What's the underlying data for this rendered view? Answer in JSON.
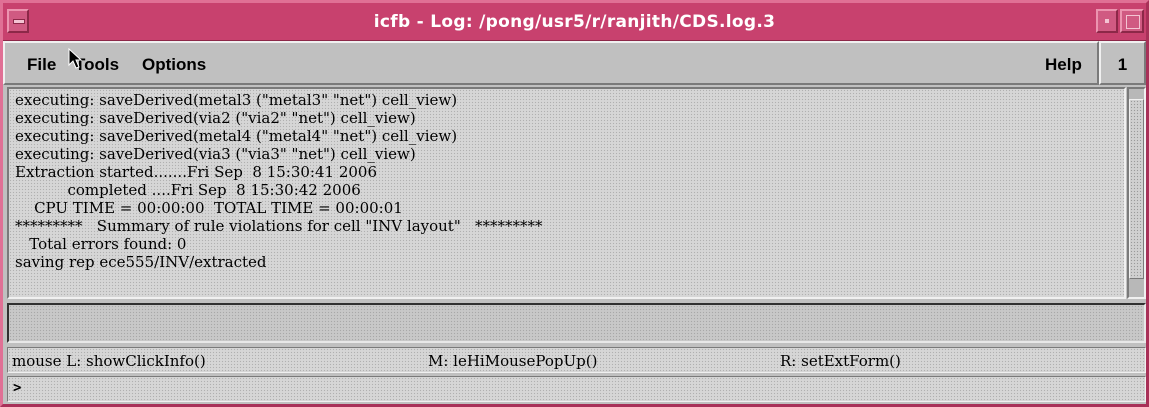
{
  "window": {
    "title": "icfb - Log: /pong/usr5/r/ranjith/CDS.log.3",
    "number": "1"
  },
  "menu": {
    "file": "File",
    "tools": "Tools",
    "options": "Options",
    "help": "Help"
  },
  "log": {
    "lines": [
      "executing: saveDerived(metal3 (\"metal3\" \"net\") cell_view)",
      "executing: saveDerived(via2 (\"via2\" \"net\") cell_view)",
      "executing: saveDerived(metal4 (\"metal4\" \"net\") cell_view)",
      "executing: saveDerived(via3 (\"via3\" \"net\") cell_view)",
      "Extraction started.......Fri Sep  8 15:30:41 2006",
      "           completed ....Fri Sep  8 15:30:42 2006",
      "    CPU TIME = 00:00:00  TOTAL TIME = 00:00:01",
      "*********   Summary of rule violations for cell \"INV layout\"   *********",
      "   Total errors found: 0",
      "saving rep ece555/INV/extracted"
    ]
  },
  "mouse_bindings": {
    "left": "mouse L: showClickInfo()",
    "middle": "M: leHiMousePopUp()",
    "right": "R: setExtForm()"
  },
  "command": {
    "prompt": ">"
  },
  "colors": {
    "titlebar": "#c8416e",
    "window_border": "#d0507a",
    "panel": "#c0c0c0"
  },
  "icons": {
    "window_menu": "window-menu-icon",
    "minimize": "minimize-icon",
    "maximize": "maximize-icon",
    "pointer": "mouse-pointer-icon"
  }
}
